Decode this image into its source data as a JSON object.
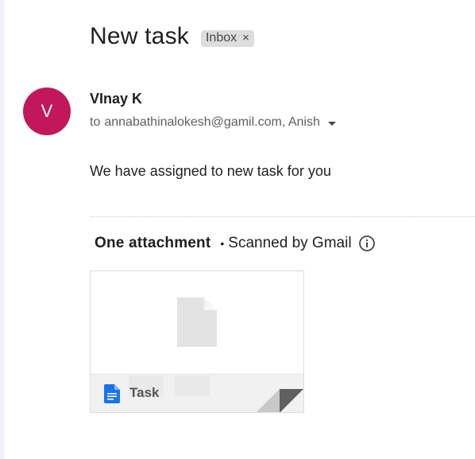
{
  "email": {
    "subject": "New task",
    "label_chip": {
      "text": "Inbox",
      "remove_glyph": "×"
    },
    "sender": {
      "avatar_letter": "V",
      "avatar_color": "#c2185b",
      "name": "VInay K"
    },
    "recipients": {
      "prefix": "to",
      "list": "annabathinalokesh@gamil.com, Anish"
    },
    "body": "We have assigned to new task for you"
  },
  "attachments": {
    "count_label": "One attachment",
    "separator": "•",
    "scan_note": "Scanned by Gmail",
    "items": [
      {
        "name": "Task",
        "icon": "google-docs-icon",
        "icon_color": "#1a73e8"
      }
    ]
  },
  "icons": {
    "chip_remove": "close-icon",
    "recipients_toggle": "caret-down-icon",
    "scan_info": "info-icon",
    "preview": "document-icon"
  }
}
